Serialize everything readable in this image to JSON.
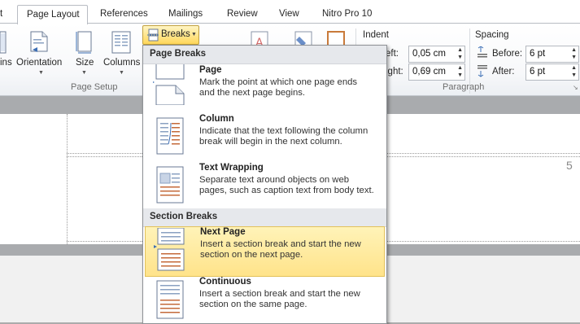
{
  "tabs": {
    "file_partial": "t",
    "page_layout": "Page Layout",
    "references": "References",
    "mailings": "Mailings",
    "review": "Review",
    "view": "View",
    "nitro": "Nitro Pro 10"
  },
  "ribbon": {
    "margins_partial": "ins",
    "orientation": "Orientation",
    "size": "Size",
    "columns": "Columns",
    "page_setup": "Page Setup",
    "breaks": "Breaks",
    "indent": "Indent",
    "spacing": "Spacing",
    "left_partial": "eft:",
    "right_partial": "ight:",
    "left_value": "0,05 cm",
    "right_value": "0,69 cm",
    "before": "Before:",
    "after": "After:",
    "before_value": "6 pt",
    "after_value": "6 pt",
    "paragraph": "Paragraph"
  },
  "menu": {
    "page_breaks_header": "Page Breaks",
    "section_breaks_header": "Section Breaks",
    "items": [
      {
        "title": "Page",
        "desc1": "Mark the point at which one page ends",
        "desc2": "and the next page begins."
      },
      {
        "title": "Column",
        "desc1": "Indicate that the text following the column",
        "desc2": "break will begin in the next column."
      },
      {
        "title": "Text Wrapping",
        "desc1": "Separate text around objects on web",
        "desc2": "pages, such as caption text from body text."
      },
      {
        "title": "Next Page",
        "desc1": "Insert a section break and start the new",
        "desc2": "section on the next page."
      },
      {
        "title": "Continuous",
        "desc1": "Insert a section break and start the new",
        "desc2": "section on the same page."
      }
    ]
  },
  "document": {
    "page_number_partial": "5"
  },
  "colors": {
    "highlight": "#ffe38a",
    "header_bg": "#e6e8ec",
    "breaks_button": "#ffd75a"
  }
}
